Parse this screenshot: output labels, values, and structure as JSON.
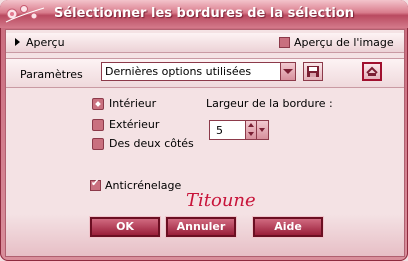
{
  "window": {
    "title": "Sélectionner les bordures de la sélection"
  },
  "preview": {
    "label": "Aperçu",
    "image_preview_label": "Aperçu de l'image",
    "image_preview_checked": false
  },
  "settings": {
    "label": "Paramètres",
    "preset_value": "Dernières options utilisées"
  },
  "border_type": {
    "options": [
      {
        "label": "Intérieur",
        "selected": true
      },
      {
        "label": "Extérieur",
        "selected": false
      },
      {
        "label": "Des deux côtés",
        "selected": false
      }
    ]
  },
  "border_width": {
    "label": "Largeur de la bordure :",
    "value": "5"
  },
  "antialias": {
    "label": "Anticrénelage",
    "checked": true
  },
  "signature": {
    "text": "Titoune"
  },
  "buttons": {
    "ok": "OK",
    "cancel": "Annuler",
    "help": "Aide"
  },
  "colors": {
    "accent": "#9a1f3a",
    "title_gradient": "#d97c8d",
    "panel": "#f4e2e4"
  }
}
